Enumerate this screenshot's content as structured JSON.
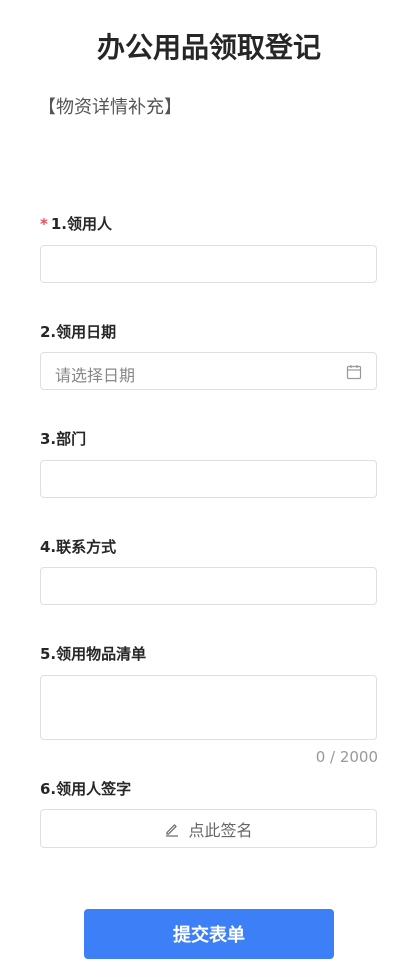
{
  "header": {
    "title": "办公用品领取登记",
    "subtitle": "【物资详情补充】"
  },
  "fields": [
    {
      "label": "1.领用人",
      "required": true
    },
    {
      "label": "2.领用日期",
      "placeholder": "请选择日期"
    },
    {
      "label": "3.部门"
    },
    {
      "label": "4.联系方式"
    },
    {
      "label": "5.领用物品清单",
      "counter": "0 / 2000"
    },
    {
      "label": "6.领用人签字",
      "sign_text": "点此签名"
    }
  ],
  "required_mark": "*",
  "submit_label": "提交表单",
  "colors": {
    "accent": "#3d7ff6",
    "required": "#e34d59"
  }
}
